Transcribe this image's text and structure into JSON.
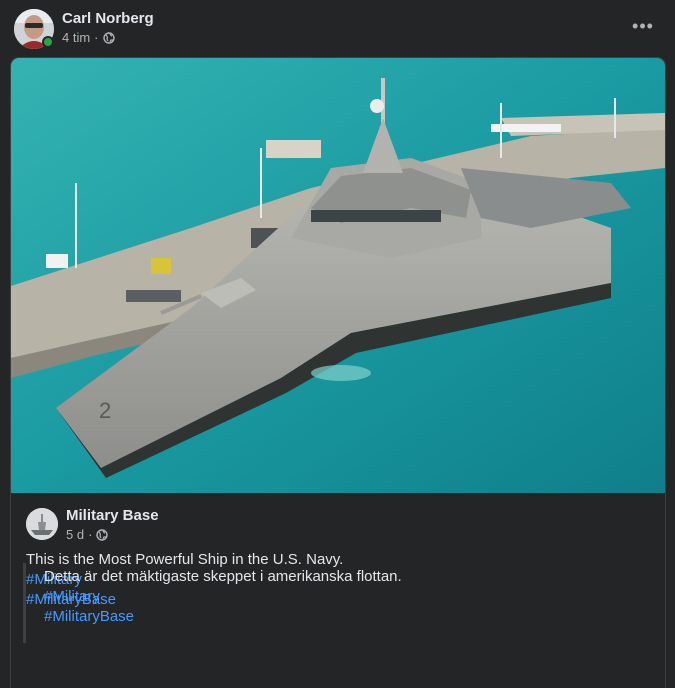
{
  "post": {
    "author": "Carl Norberg",
    "time": "4 tim",
    "separator": "·",
    "privacy_icon": "globe-icon",
    "more_icon": "more-horizontal-icon",
    "more_label": "•••",
    "online": true
  },
  "shared": {
    "image_subject": "warship-photo",
    "page_name": "Military Base",
    "time": "5 d",
    "separator": "·",
    "privacy_icon": "globe-icon",
    "text": "This is the Most Powerful Ship in the U.S. Navy.",
    "hashtags": [
      "#Military",
      "#MilitaryBase"
    ],
    "translation": {
      "text": "Detta är det mäktigaste skeppet i amerikanska flottan.",
      "hashtags": [
        "#Military",
        "#MilitaryBase"
      ]
    }
  },
  "colors": {
    "background": "#242526",
    "link": "#4599ff",
    "online": "#31a24c",
    "secondary_text": "#b0b3b8"
  }
}
